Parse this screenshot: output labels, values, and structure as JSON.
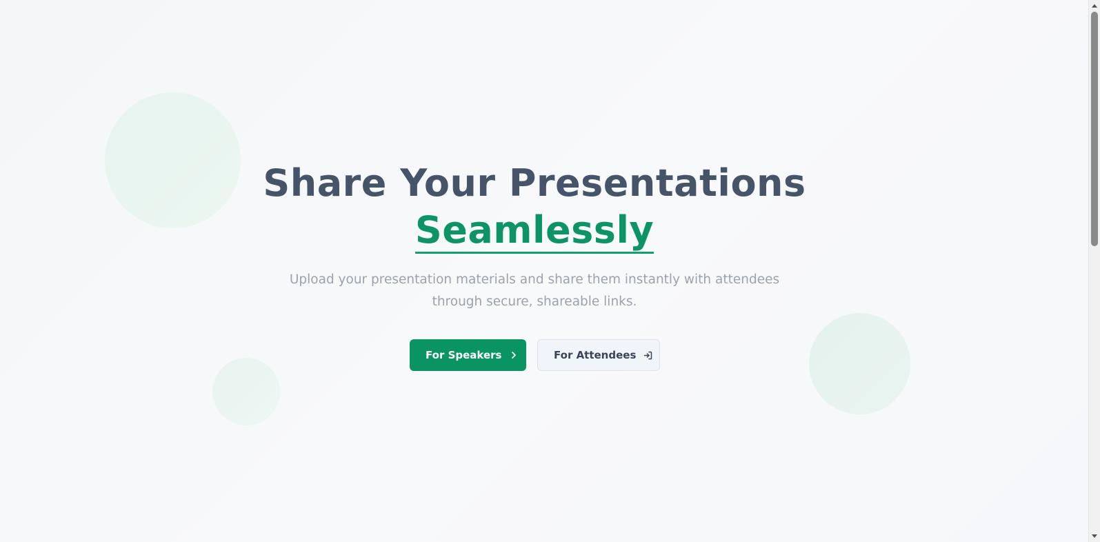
{
  "hero": {
    "title_line1": "Share Your Presentations",
    "title_line2": "Seamlessly",
    "subtitle_line1": "Upload your presentation materials and share them instantly with attendees",
    "subtitle_line2": "through secure, shareable links."
  },
  "actions": {
    "speakers_label": "For Speakers",
    "speakers_icon": "chevron-right-icon",
    "attendees_label": "For Attendees",
    "attendees_icon": "sign-in-icon"
  },
  "colors": {
    "accent": "#0a9464",
    "heading": "#455468",
    "subtitle": "#9ba2ac",
    "secondary_button_bg": "#f1f4f8"
  }
}
